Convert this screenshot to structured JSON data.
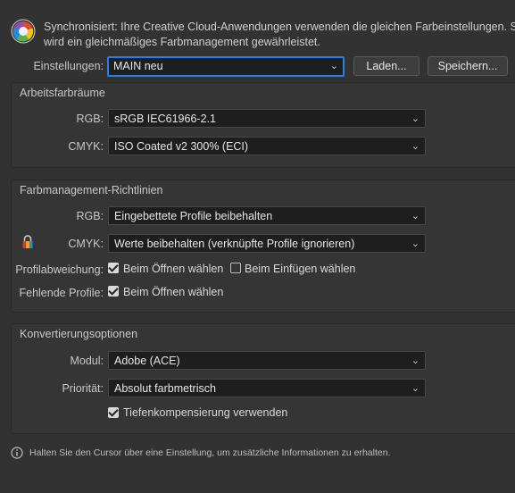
{
  "sync": {
    "line1": "Synchronisiert: Ihre Creative Cloud-Anwendungen verwenden die gleichen Farbeinstellungen. Somit",
    "line2": "wird ein gleichmäßiges Farbmanagement gewährleistet.",
    "icon": "color-wheel-icon"
  },
  "settings": {
    "label": "Einstellungen:",
    "value": "MAIN neu",
    "load_button": "Laden...",
    "save_button": "Speichern..."
  },
  "workspaces": {
    "title": "Arbeitsfarbräume",
    "rgb_label": "RGB:",
    "rgb_value": "sRGB IEC61966-2.1",
    "cmyk_label": "CMYK:",
    "cmyk_value": "ISO Coated v2 300% (ECI)"
  },
  "policies": {
    "title": "Farbmanagement-Richtlinien",
    "rgb_label": "RGB:",
    "rgb_value": "Eingebettete Profile beibehalten",
    "cmyk_label": "CMYK:",
    "cmyk_value": "Werte beibehalten (verknüpfte Profile ignorieren)",
    "lock_icon": "lock-icon",
    "mismatch_label": "Profilabweichung:",
    "mismatch_open": "Beim Öffnen wählen",
    "mismatch_open_checked": true,
    "mismatch_paste": "Beim Einfügen wählen",
    "mismatch_paste_checked": false,
    "missing_label": "Fehlende Profile:",
    "missing_open": "Beim Öffnen wählen",
    "missing_open_checked": true
  },
  "conversion": {
    "title": "Konvertierungsoptionen",
    "engine_label": "Modul:",
    "engine_value": "Adobe (ACE)",
    "intent_label": "Priorität:",
    "intent_value": "Absolut farbmetrisch",
    "bpc_label": "Tiefenkompensierung verwenden",
    "bpc_checked": true
  },
  "info": {
    "text": "Halten Sie den Cursor über eine Einstellung, um zusätzliche Informationen zu erhalten.",
    "icon": "info-icon"
  }
}
